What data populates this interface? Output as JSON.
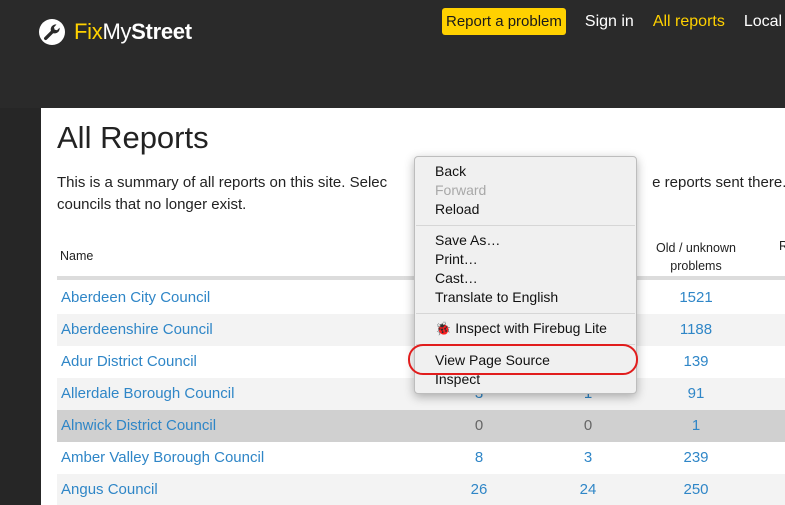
{
  "header": {
    "logo": {
      "fix": "Fix",
      "my": "My",
      "street": "Street",
      "icon": "wrench-icon"
    },
    "nav": {
      "report_button": "Report a problem",
      "sign_in": "Sign in",
      "all_reports": "All reports",
      "local_alerts": "Local al"
    }
  },
  "main": {
    "title": "All Reports",
    "intro_line1": "This is a summary of all reports on this site. Selec",
    "intro_line1_tail": "e reports sent there. C",
    "intro_line2": "councils that no longer exist.",
    "table": {
      "headers": {
        "name": "Name",
        "old_line1": "Old / unknown",
        "old_line2": "problems",
        "r": "R"
      },
      "rows": [
        {
          "name": "Aberdeen City Council",
          "c1": "",
          "c2": "",
          "c3": "1521"
        },
        {
          "name": "Aberdeenshire Council",
          "c1": "",
          "c2": "",
          "c3": "1188"
        },
        {
          "name": "Adur District Council",
          "c1": "",
          "c2": "",
          "c3": "139"
        },
        {
          "name": "Allerdale Borough Council",
          "c1": "3",
          "c2": "1",
          "c3": "91"
        },
        {
          "name": "Alnwick District Council",
          "c1": "0",
          "c2": "0",
          "c3": "1"
        },
        {
          "name": "Amber Valley Borough Council",
          "c1": "8",
          "c2": "3",
          "c3": "239"
        },
        {
          "name": "Angus Council",
          "c1": "26",
          "c2": "24",
          "c3": "250"
        }
      ]
    }
  },
  "context_menu": {
    "back": "Back",
    "forward": "Forward",
    "reload": "Reload",
    "save_as": "Save As…",
    "print": "Print…",
    "cast": "Cast…",
    "translate": "Translate to English",
    "firebug": "Inspect with Firebug Lite",
    "view_source": "View Page Source",
    "inspect": "Inspect"
  },
  "colors": {
    "brand_yellow": "#ffd100",
    "link_blue": "#2f86c7",
    "highlight_red": "#e11c1c",
    "header_bg": "#2a2a2a"
  }
}
